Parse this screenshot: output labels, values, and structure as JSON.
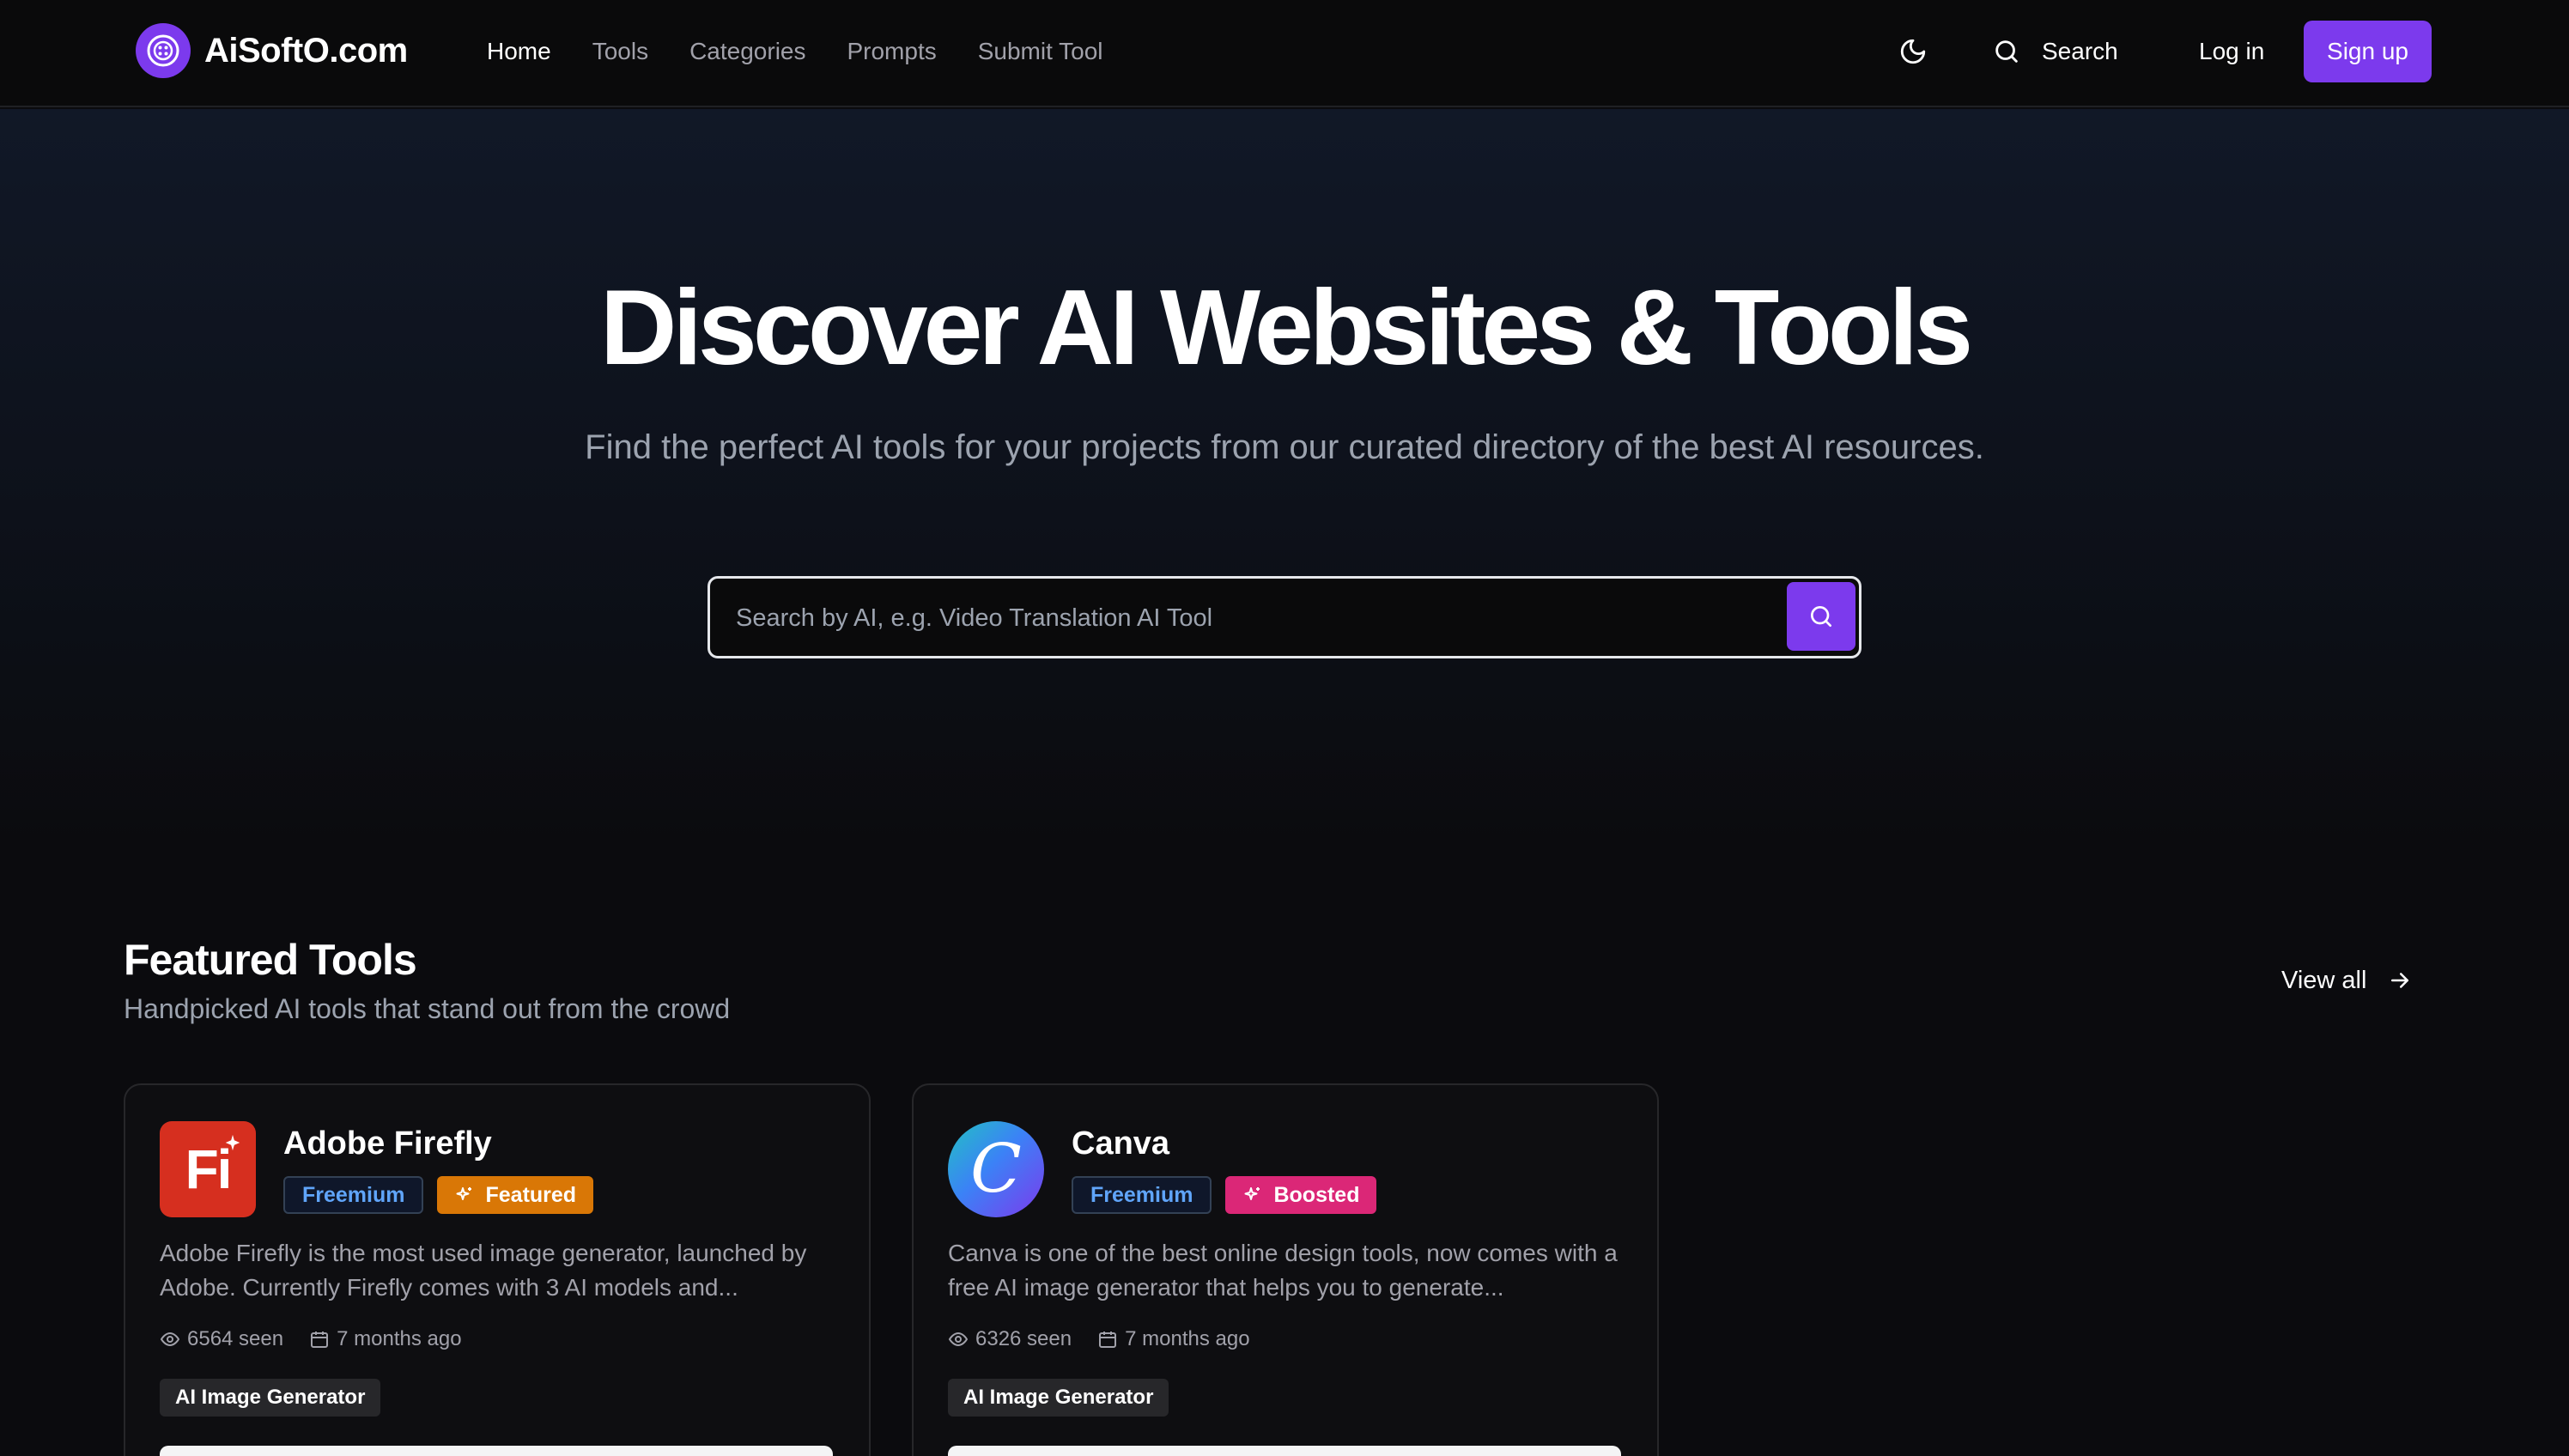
{
  "header": {
    "logo_text": "AiSoftO.com",
    "nav": [
      {
        "label": "Home",
        "active": true
      },
      {
        "label": "Tools",
        "active": false
      },
      {
        "label": "Categories",
        "active": false
      },
      {
        "label": "Prompts",
        "active": false
      },
      {
        "label": "Submit Tool",
        "active": false
      }
    ],
    "search_label": "Search",
    "login_label": "Log in",
    "signup_label": "Sign up"
  },
  "hero": {
    "title": "Discover AI Websites & Tools",
    "subtitle": "Find the perfect AI tools for your projects from our curated directory of the best AI resources.",
    "search_placeholder": "Search by AI, e.g. Video Translation AI Tool"
  },
  "featured": {
    "title": "Featured Tools",
    "subtitle": "Handpicked AI tools that stand out from the crowd",
    "view_all_label": "View all",
    "cards": [
      {
        "name": "Adobe Firefly",
        "logo_text": "Fi",
        "pricing": "Freemium",
        "highlight": "Featured",
        "description": "Adobe Firefly is the most used image generator, launched by Adobe. Currently Firefly comes with 3 AI models and...",
        "views": "6564 seen",
        "date": "7 months ago",
        "category": "AI Image Generator"
      },
      {
        "name": "Canva",
        "logo_text": "C",
        "pricing": "Freemium",
        "highlight": "Boosted",
        "description": "Canva is one of the best online design tools, now comes with a free AI image generator that helps you to generate...",
        "views": "6326 seen",
        "date": "7 months ago",
        "category": "AI Image Generator"
      }
    ]
  },
  "colors": {
    "accent": "#7c3aed",
    "background": "#0b0b0e",
    "featured_badge": "#d97706",
    "boosted_badge": "#db2777",
    "freemium_text": "#60a5fa"
  },
  "icons": [
    "logo-icon",
    "moon-icon",
    "search-icon",
    "arrow-right-icon",
    "sparkle-icon",
    "eye-icon",
    "calendar-icon"
  ]
}
